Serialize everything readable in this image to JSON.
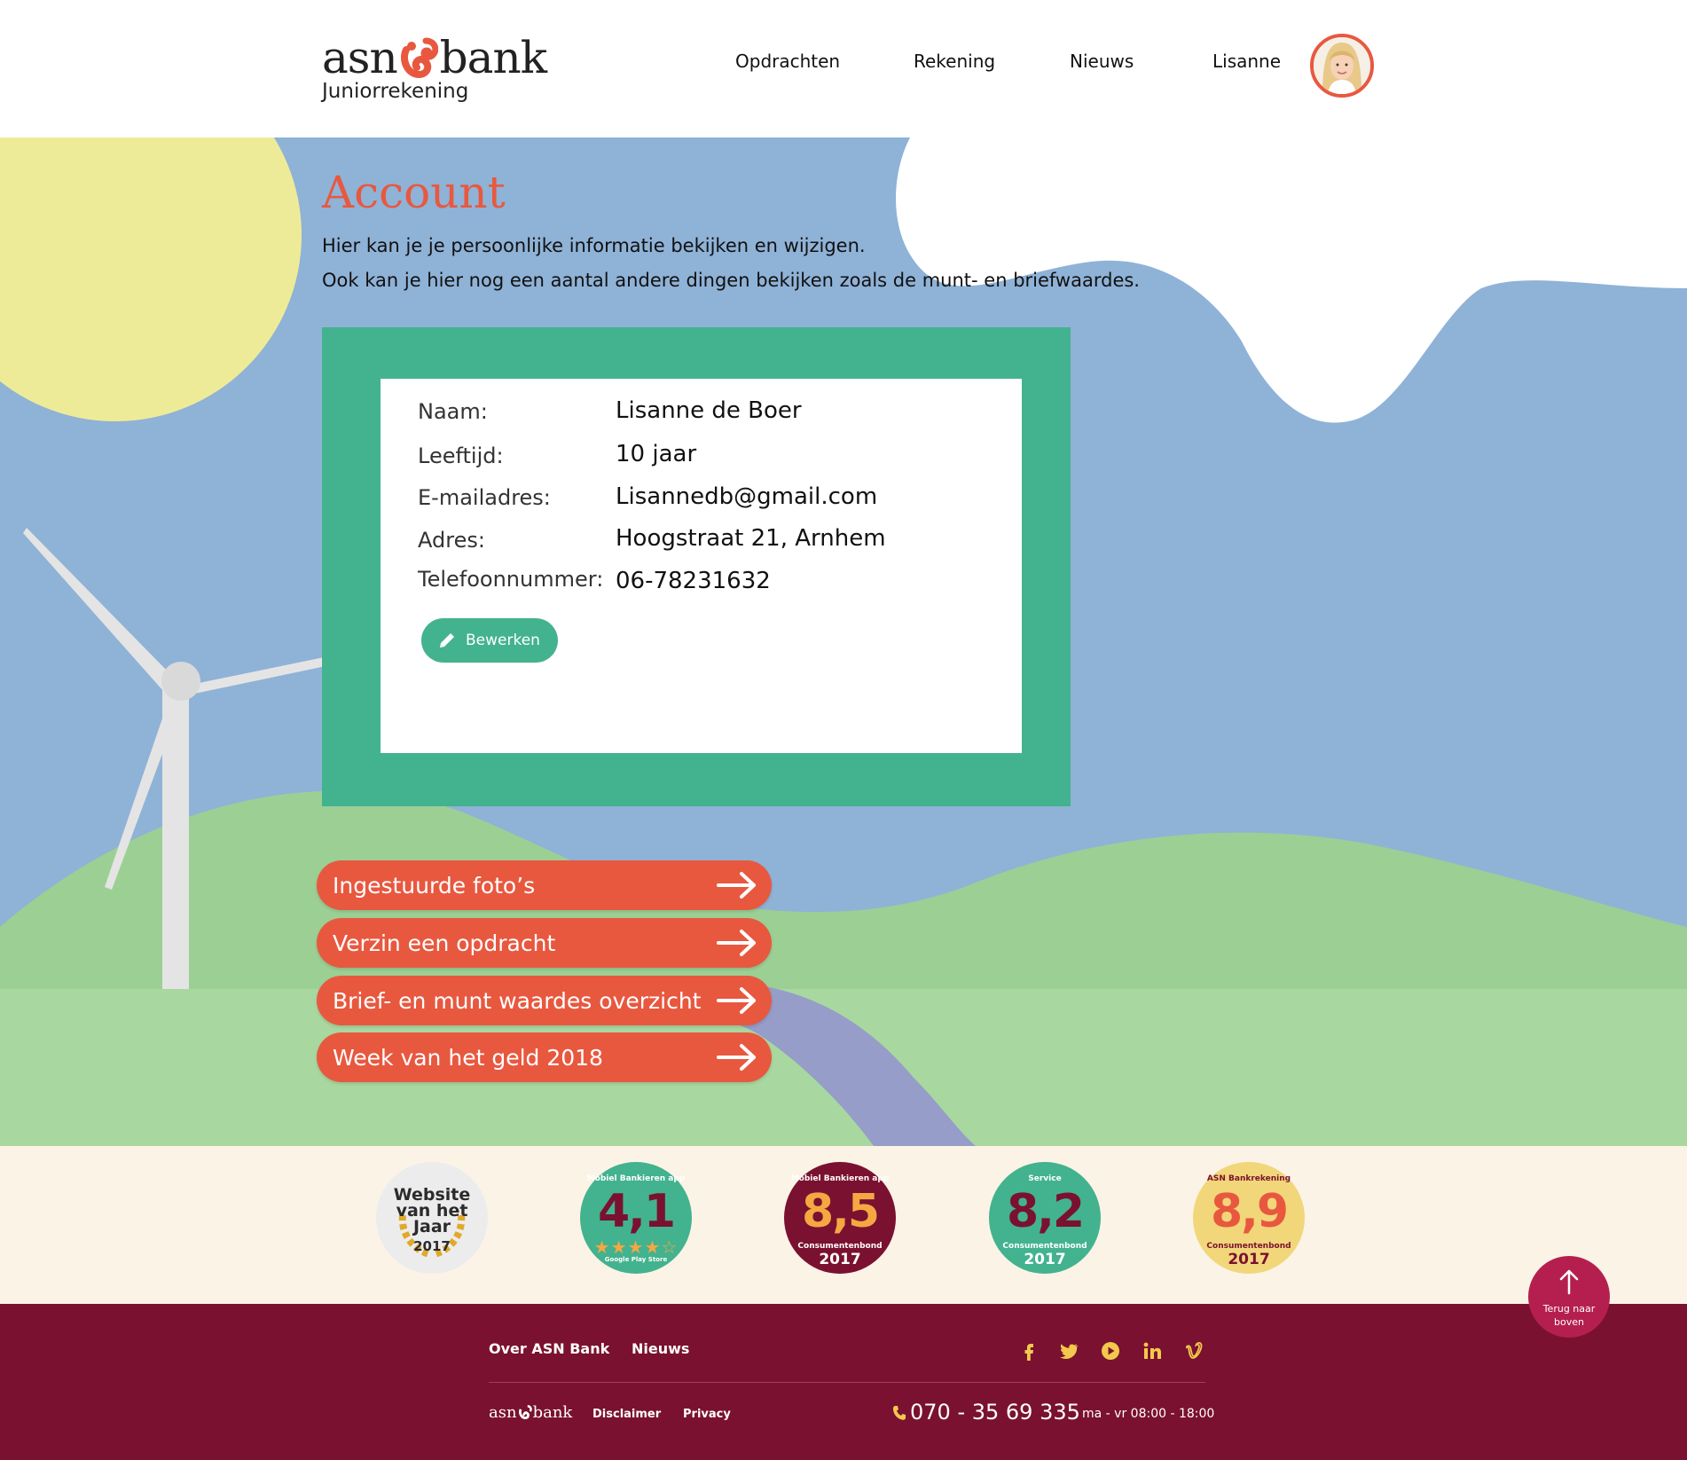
{
  "header": {
    "logo_text": "asn",
    "logo_text_2": "bank",
    "logo_subtitle": "Juniorrekening",
    "nav": [
      {
        "label": "Opdrachten"
      },
      {
        "label": "Rekening"
      },
      {
        "label": "Nieuws"
      },
      {
        "label": "Lisanne"
      }
    ]
  },
  "main": {
    "title": "Account",
    "intro_1": "Hier kan je je persoonlijke informatie bekijken en wijzigen.",
    "intro_2": "Ook kan je hier nog een aantal andere dingen bekijken zoals de munt- en briefwaardes.",
    "fields": [
      {
        "label": "Naam:",
        "value": "Lisanne de Boer"
      },
      {
        "label": "Leeftijd:",
        "value": "10 jaar"
      },
      {
        "label": "E-mailadres:",
        "value": "Lisannedb@gmail.com"
      },
      {
        "label": "Adres:",
        "value": "Hoogstraat 21, Arnhem"
      },
      {
        "label": "Telefoonnummer:",
        "value": "06-78231632"
      }
    ],
    "edit_label": "Bewerken",
    "links": [
      {
        "label": "Ingestuurde foto’s"
      },
      {
        "label": "Verzin een opdracht"
      },
      {
        "label": "Brief- en munt waardes overzicht"
      },
      {
        "label": "Week van het geld 2018"
      }
    ]
  },
  "awards": [
    {
      "top": "",
      "num": "Website van het Jaar",
      "sub": "",
      "year": "2017"
    },
    {
      "top": "Mobiel Bankieren app",
      "num": "4,1",
      "sub": "Google Play Store",
      "year": ""
    },
    {
      "top": "Mobiel Bankieren app",
      "num": "8,5",
      "sub": "Consumentenbond",
      "year": "2017"
    },
    {
      "top": "Service",
      "num": "8,2",
      "sub": "Consumentenbond",
      "year": "2017"
    },
    {
      "top": "ASN Bankrekening",
      "num": "8,9",
      "sub": "Consumentenbond",
      "year": "2017"
    }
  ],
  "back_to_top": {
    "line1": "Terug naar",
    "line2": "boven"
  },
  "footer": {
    "links": [
      {
        "label": "Over ASN Bank"
      },
      {
        "label": "Nieuws"
      }
    ],
    "logo_text": "asn",
    "logo_text_2": "bank",
    "small_links": [
      {
        "label": "Disclaimer"
      },
      {
        "label": "Privacy"
      }
    ],
    "phone": "070 - 35 69 335",
    "hours": "ma - vr 08:00 - 18:00",
    "social": [
      "facebook-icon",
      "twitter-icon",
      "youtube-icon",
      "linkedin-icon",
      "vimeo-icon"
    ]
  },
  "colors": {
    "brand_red": "#e8583f",
    "brand_green": "#43b28f",
    "sky": "#8fb2d7",
    "footer": "#7a1130"
  }
}
